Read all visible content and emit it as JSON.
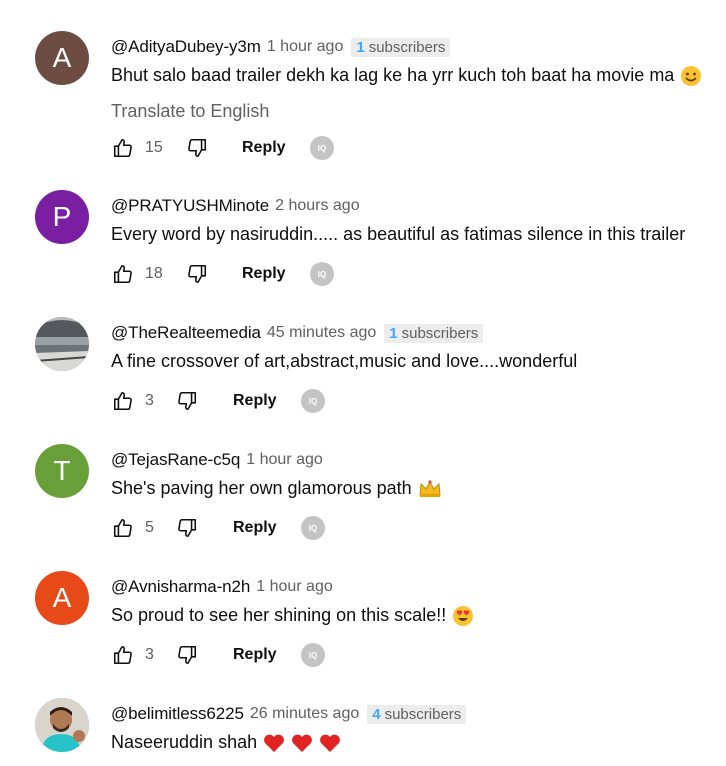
{
  "comments": [
    {
      "author": "@AdityaDubey-y3m",
      "time": "1 hour ago",
      "subs_num": "1",
      "subs_label": "subscribers",
      "text": "Bhut salo baad trailer dekh ka lag ke ha yrr kuch toh baat ha movie ma",
      "translate": "Translate to English",
      "likes": "15",
      "reply": "Reply",
      "avatar_letter": "A",
      "avatar_color": "#6d4c41",
      "emoji": "smile"
    },
    {
      "author": "@PRATYUSHMinote",
      "time": "2 hours ago",
      "text": "Every word by nasiruddin..... as beautiful as fatimas silence in this trailer",
      "likes": "18",
      "reply": "Reply",
      "avatar_letter": "P",
      "avatar_color": "#7b1fa2"
    },
    {
      "author": "@TheRealteemedia",
      "time": "45 minutes ago",
      "subs_num": "1",
      "subs_label": "subscribers",
      "text": "A fine crossover of art,abstract,music and love....wonderful",
      "likes": "3",
      "reply": "Reply",
      "avatar": "station-photo"
    },
    {
      "author": "@TejasRane-c5q",
      "time": "1 hour ago",
      "text": "She's paving her own glamorous path",
      "likes": "5",
      "reply": "Reply",
      "avatar_letter": "T",
      "avatar_color": "#689f38",
      "emoji": "crown"
    },
    {
      "author": "@Avnisharma-n2h",
      "time": "1 hour ago",
      "text": "So proud to see her shining on this scale!!",
      "likes": "3",
      "reply": "Reply",
      "avatar_letter": "A",
      "avatar_color": "#e64a19",
      "emoji": "heart-eyes"
    },
    {
      "author": "@belimitless6225",
      "time": "26 minutes ago",
      "subs_num": "4",
      "subs_label": "subscribers",
      "text": "Naseeruddin shah",
      "avatar": "person-photo",
      "emoji": "three-hearts"
    }
  ],
  "icons": {
    "like": "thumbs-up-icon",
    "dislike": "thumbs-down-icon",
    "extension": "iq-icon",
    "extension_text": "IQ"
  }
}
